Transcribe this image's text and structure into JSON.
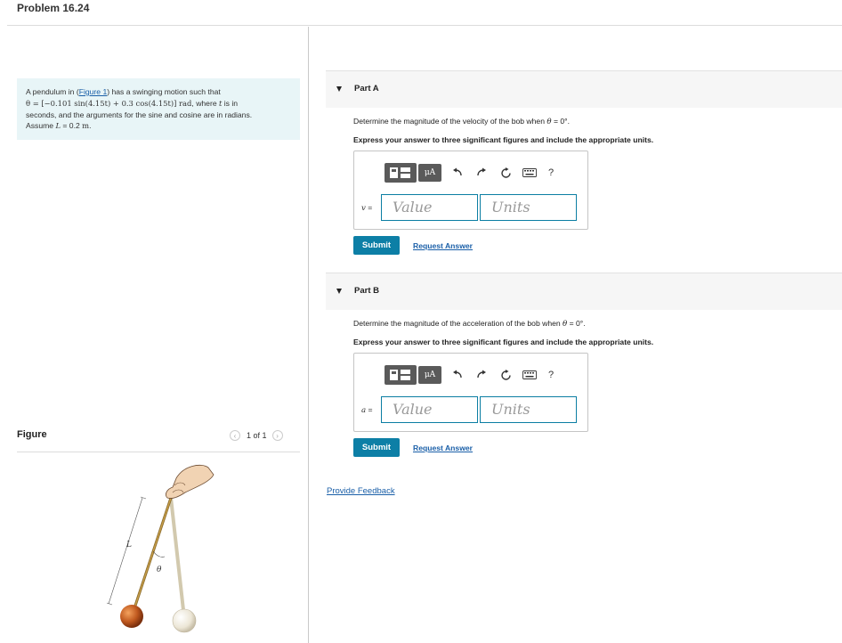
{
  "header": {
    "title": "Problem 16.24"
  },
  "intro": {
    "p1": "A pendulum in (",
    "link": "Figure 1",
    "p2": ") has a swinging motion such that",
    "eq": "θ = [−0.101 sin(4.15t) + 0.3 cos(4.15t)] rad",
    "p3": ", where ",
    "t": "t",
    "p4": " is in",
    "line3": "seconds, and the arguments for the sine and cosine are in radians.",
    "p5": "Assume ",
    "L": "L",
    "p6": " = 0.2 ",
    "unit": "m",
    "p7": "."
  },
  "figure": {
    "label": "Figure",
    "counter": "1 of 1",
    "prev_icon": "chevron-left-icon",
    "next_icon": "chevron-right-icon",
    "L_label": "L",
    "theta_label": "θ"
  },
  "parts": [
    {
      "title": "Part A",
      "question_pre": "Determine the magnitude of the velocity of the bob when ",
      "question_var": "θ",
      "question_post": " = 0°.",
      "instruction": "Express your answer to three significant figures and include the appropriate units.",
      "var_name": "v",
      "var_eq": " =",
      "value_placeholder": "Value",
      "units_placeholder": "Units",
      "submit_label": "Submit",
      "request_label": "Request Answer"
    },
    {
      "title": "Part B",
      "question_pre": "Determine the magnitude of the acceleration of the bob when ",
      "question_var": "θ",
      "question_post": " = 0°.",
      "instruction": "Express your answer to three significant figures and include the appropriate units.",
      "var_name": "a",
      "var_eq": " =",
      "value_placeholder": "Value",
      "units_placeholder": "Units",
      "submit_label": "Submit",
      "request_label": "Request Answer"
    }
  ],
  "toolbar": {
    "mu_label": "μA",
    "help_label": "?",
    "icons": [
      "templates-icon",
      "units-mu-icon",
      "undo-icon",
      "redo-icon",
      "reset-icon",
      "keyboard-icon",
      "help-icon"
    ]
  },
  "feedback": {
    "label": "Provide Feedback"
  },
  "colors": {
    "accent": "#0d7fa6",
    "link": "#1a5fa8",
    "intro_bg": "#e8f5f7",
    "bob": "#c0591f"
  }
}
